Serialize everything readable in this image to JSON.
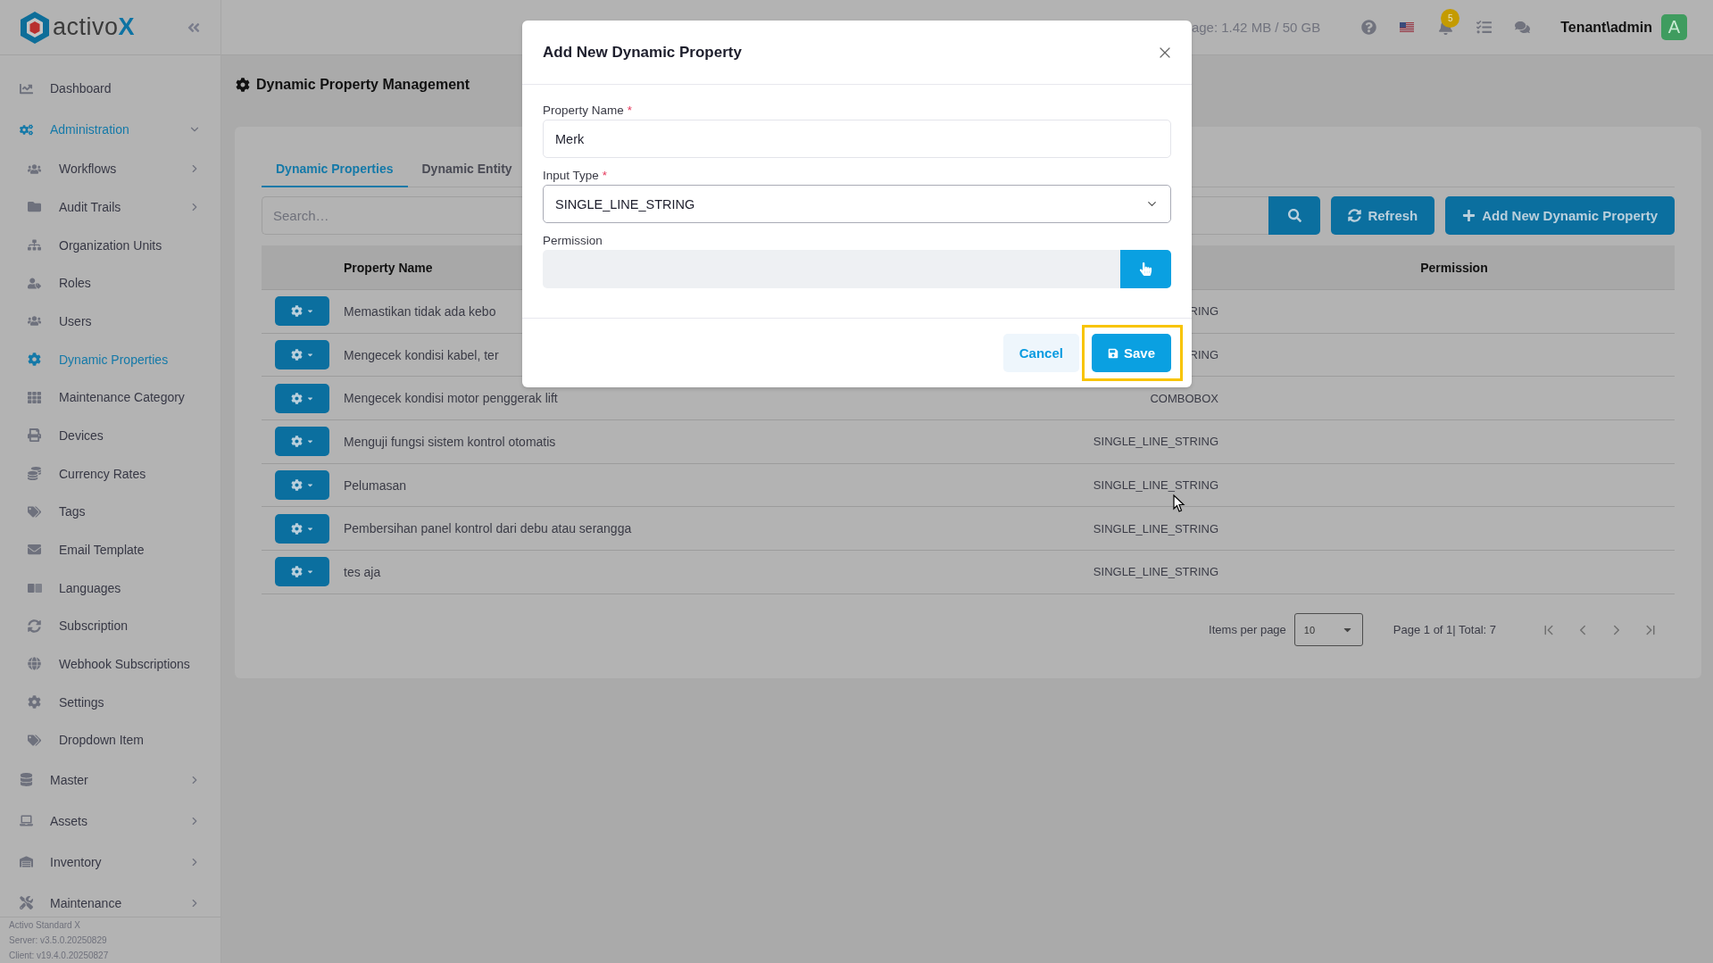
{
  "sidebar": {
    "logo": "activo",
    "logo_accent": "X",
    "items": [
      {
        "label": "Dashboard",
        "selected": false
      },
      {
        "label": "Administration",
        "selected": true,
        "expanded": true,
        "children": [
          {
            "label": "Workflows",
            "selected": false,
            "expanded": false
          },
          {
            "label": "Audit Trails",
            "selected": false,
            "expanded": false
          },
          {
            "label": "Organization Units",
            "selected": false
          },
          {
            "label": "Roles",
            "selected": false
          },
          {
            "label": "Users",
            "selected": false
          },
          {
            "label": "Dynamic Properties",
            "selected": true
          },
          {
            "label": "Maintenance Category",
            "selected": false
          },
          {
            "label": "Devices",
            "selected": false
          },
          {
            "label": "Currency Rates",
            "selected": false
          },
          {
            "label": "Tags",
            "selected": false
          },
          {
            "label": "Email Template",
            "selected": false
          },
          {
            "label": "Languages",
            "selected": false
          },
          {
            "label": "Subscription",
            "selected": false
          },
          {
            "label": "Webhook Subscriptions",
            "selected": false
          },
          {
            "label": "Settings",
            "selected": false
          },
          {
            "label": "Dropdown Item",
            "selected": false
          }
        ]
      },
      {
        "label": "Master",
        "selected": false,
        "expanded": false
      },
      {
        "label": "Assets",
        "selected": false,
        "expanded": false
      },
      {
        "label": "Inventory",
        "selected": false,
        "expanded": false
      },
      {
        "label": "Maintenance",
        "selected": false,
        "expanded": false
      }
    ],
    "footer": [
      "Activo Standard X",
      "Server: v3.5.0.20250829",
      "Client: v19.4.0.20250827"
    ]
  },
  "header": {
    "storage": "age: 1.42 MB / 50 GB",
    "notifications": "5",
    "user": "Tenant\\admin",
    "avatar": "A"
  },
  "page": {
    "title": "Dynamic Property Management"
  },
  "tabs": [
    {
      "label": "Dynamic Properties",
      "selected": true
    },
    {
      "label": "Dynamic Entity",
      "selected": false
    }
  ],
  "toolbar": {
    "search_placeholder": "Search…",
    "buttons": [
      {
        "kind": "refresh",
        "label": "Refresh"
      },
      {
        "kind": "add",
        "label": "Add New Dynamic Property"
      }
    ]
  },
  "table": {
    "columns": [
      "Property Name",
      "Permission"
    ],
    "rows": [
      {
        "name": "Memastikan tidak ada kebo",
        "input_type": "RING"
      },
      {
        "name": "Mengecek kondisi kabel, ter",
        "input_type": "RING"
      },
      {
        "name": "Mengecek kondisi motor penggerak lift",
        "input_type": "COMBOBOX"
      },
      {
        "name": "Menguji fungsi sistem kontrol otomatis",
        "input_type": "SINGLE_LINE_STRING"
      },
      {
        "name": "Pelumasan",
        "input_type": "SINGLE_LINE_STRING"
      },
      {
        "name": "Pembersihan panel kontrol dari debu atau serangga",
        "input_type": "SINGLE_LINE_STRING"
      },
      {
        "name": "tes aja",
        "input_type": "SINGLE_LINE_STRING"
      }
    ]
  },
  "pagination": {
    "label": "Items per page",
    "page_size": "10",
    "summary": "Page 1 of 1| Total: 7"
  },
  "modal": {
    "title": "Add New Dynamic Property",
    "fields": [
      {
        "kind": "text",
        "label": "Property Name",
        "required_mark": "*",
        "value": "Merk"
      },
      {
        "kind": "select",
        "label": "Input Type",
        "required_mark": "*",
        "value": "SINGLE_LINE_STRING"
      },
      {
        "kind": "picker",
        "label": "Permission"
      }
    ],
    "buttons": [
      {
        "kind": "cancel",
        "label": "Cancel",
        "highlighted": false
      },
      {
        "kind": "save",
        "label": "Save",
        "highlighted": true
      }
    ]
  }
}
